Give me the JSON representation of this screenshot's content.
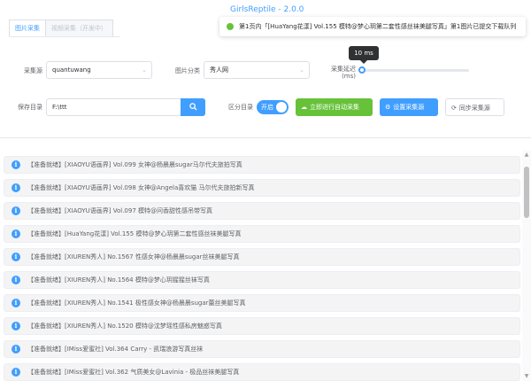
{
  "tabs": [
    "图片采集",
    "视频采集（开发中）"
  ],
  "app_title": "GirlsReptile - 2.0.0",
  "notification": {
    "message": "第1页内「[HuaYang花漾] Vol.155 模特@梦心玥第二套性感丝袜美腿写真」第1图片已提交下载队列",
    "status_color": "#67c23a"
  },
  "form": {
    "source_label": "采集源",
    "source_value": "quantuwang",
    "category_label": "图片分类",
    "category_value": "秀人网",
    "delay_label": "采集延迟",
    "delay_unit": "(ms)",
    "delay_value_ms": 10,
    "delay_tooltip": "10 ms",
    "save_label": "保存目录",
    "save_value": "F:\\ttt",
    "distinguish_label": "区分目录",
    "toggle_text": "开启",
    "toggle_on": true
  },
  "buttons": {
    "start": "立即进行自动采集",
    "settings": "设置采集源",
    "sync": "同步采集源"
  },
  "icons": {
    "chevron": "chevron-down-icon",
    "search": "search-icon",
    "cloud": "cloud-upload-icon",
    "settings": "settings-icon",
    "sync": "sync-icon",
    "info": "info-icon"
  },
  "colors": {
    "primary": "#409eff",
    "success": "#67c23a"
  },
  "list": [
    "【准备就绪】[XIAOYU语画界] Vol.099 女神@杨晨晨sugar马尔代夫旅拍写真",
    "【准备就绪】[XIAOYU语画界] Vol.098 女神@Angela喜欢猫 马尔代夫旅拍新写真",
    "【准备就绪】[XIAOYU语画界] Vol.097 模特@问香甜性感吊带写真",
    "【准备就绪】[HuaYang花漾] Vol.155 模特@梦心玥第二套性感丝袜美腿写真",
    "【准备就绪】[XIUREN秀人] No.1567 性感女神@杨晨晨sugar丝袜美腿写真",
    "【准备就绪】[XIUREN秀人] No.1564 模特@梦心玥猩猩丝袜写真",
    "【准备就绪】[XIUREN秀人] No.1541 极性感女神@杨晨晨sugar蕾丝美腿写真",
    "【准备就绪】[XIUREN秀人] No.1520 模特@沈梦瑶性感私房魅惑写真",
    "【准备就绪】[IMiss爱蜜社] Vol.364 Carry - 凯瑞浪游写真丝袜",
    "【准备就绪】[IMiss爱蜜社] Vol.362 气质美女@Lavinia - 极品丝袜美腿写真"
  ]
}
